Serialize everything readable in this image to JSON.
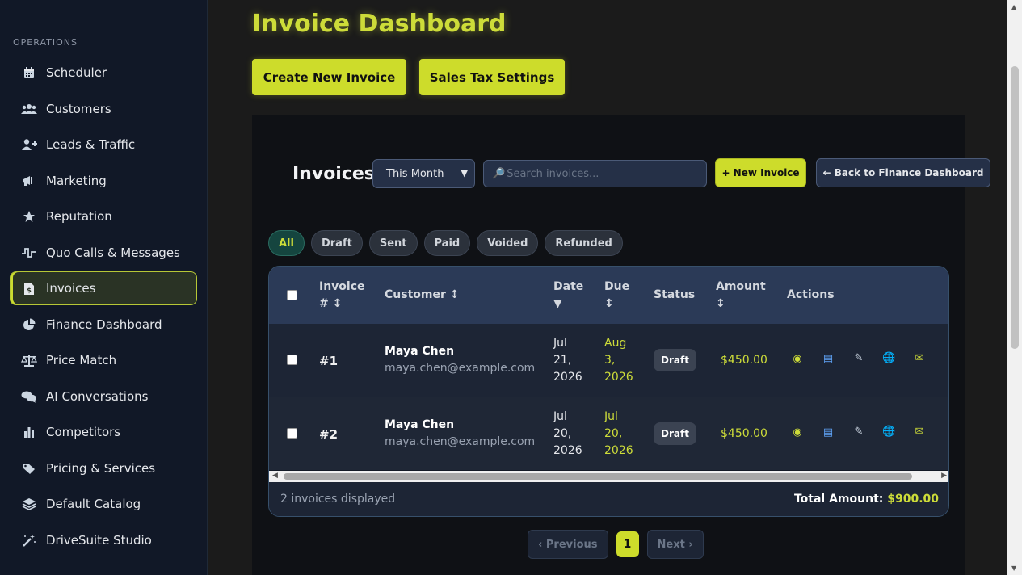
{
  "sidebar": {
    "section_label": "OPERATIONS",
    "items": [
      {
        "label": "Scheduler",
        "icon": "calendar-icon"
      },
      {
        "label": "Customers",
        "icon": "users-icon"
      },
      {
        "label": "Leads & Traffic",
        "icon": "user-plus-icon"
      },
      {
        "label": "Marketing",
        "icon": "megaphone-icon"
      },
      {
        "label": "Reputation",
        "icon": "star-icon"
      },
      {
        "label": "Quo Calls & Messages",
        "icon": "waveform-icon"
      },
      {
        "label": "Invoices",
        "icon": "invoice-file-icon",
        "active": true
      },
      {
        "label": "Finance Dashboard",
        "icon": "pie-chart-icon"
      },
      {
        "label": "Price Match",
        "icon": "scale-icon"
      },
      {
        "label": "AI Conversations",
        "icon": "chat-bubbles-icon"
      },
      {
        "label": "Competitors",
        "icon": "bar-chart-icon"
      },
      {
        "label": "Pricing & Services",
        "icon": "tag-icon"
      },
      {
        "label": "Default Catalog",
        "icon": "layers-icon"
      },
      {
        "label": "DriveSuite Studio",
        "icon": "magic-wand-icon"
      }
    ]
  },
  "header": {
    "title": "Invoice Dashboard",
    "create_button": "Create New Invoice",
    "tax_button": "Sales Tax Settings"
  },
  "panel": {
    "title": "Invoices",
    "period_selected": "This Month",
    "search_placeholder": "Search invoices...",
    "new_invoice_button": "+ New Invoice",
    "back_button": "← Back to Finance Dashboard",
    "filters": [
      "All",
      "Draft",
      "Sent",
      "Paid",
      "Voided",
      "Refunded"
    ],
    "active_filter": "All"
  },
  "table": {
    "columns": {
      "invoice": "Invoice # ↕",
      "customer": "Customer ↕",
      "date": "Date ▼",
      "due": "Due ↕",
      "status": "Status",
      "amount": "Amount ↕",
      "actions": "Actions"
    },
    "rows": [
      {
        "number": "#1",
        "customer_name": "Maya Chen",
        "customer_email": "maya.chen@example.com",
        "date": [
          "Jul",
          "21,",
          "2026"
        ],
        "due": [
          "Aug",
          "3,",
          "2026"
        ],
        "status": "Draft",
        "amount": "$450.00"
      },
      {
        "number": "#2",
        "customer_name": "Maya Chen",
        "customer_email": "maya.chen@example.com",
        "date": [
          "Jul",
          "20,",
          "2026"
        ],
        "due": [
          "Jul",
          "20,",
          "2026"
        ],
        "status": "Draft",
        "amount": "$450.00"
      }
    ],
    "action_icons": [
      "view-eye-icon",
      "credit-card-icon",
      "edit-pencil-icon",
      "globe-icon",
      "email-icon",
      "delete-icon"
    ],
    "footer_count": "2 invoices displayed",
    "footer_total_label": "Total Amount:",
    "footer_total_value": "$900.00"
  },
  "pagination": {
    "previous": "‹ Previous",
    "current": "1",
    "next": "Next ›"
  },
  "colors": {
    "accent": "#cddc2b",
    "sidebar_bg": "#111827",
    "panel_bg": "#0f1115",
    "table_header": "#2b3a57"
  }
}
